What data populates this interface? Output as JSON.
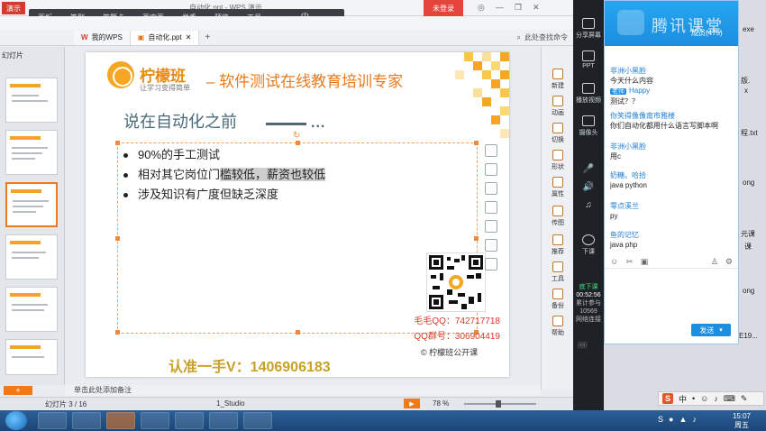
{
  "wps": {
    "title": "自动化.ppt - WPS 演示",
    "logo": "演示",
    "login_button": "未登录",
    "tabs": [
      {
        "label": "我的WPS"
      },
      {
        "label": "自动化.ppt"
      }
    ],
    "search_placeholder": "此处查找命令",
    "thumbnail_panel_label": "幻灯片",
    "notes_placeholder": "单击此处添加备注",
    "status": {
      "slide_index": "幻灯片 3 / 16",
      "theme": "1_Studio",
      "zoom": "78 %"
    }
  },
  "recorder_toolbar": {
    "items": [
      "画板",
      "签到",
      "答题卡",
      "画中画",
      "举手",
      "预览",
      "工具"
    ]
  },
  "slide": {
    "brand_name": "柠檬班",
    "brand_slogan": "让学习变得简单",
    "headline": "– 软件测试在线教育培训专家",
    "title": "说在自动化之前",
    "title_suffix": "...",
    "bullets": [
      {
        "text": "90%的手工测试"
      },
      {
        "text_a": "相对其它岗位门",
        "text_b": "槛较低，薪资也较低"
      },
      {
        "text": "涉及知识有广度但缺乏深度"
      }
    ],
    "qq_line": "毛毛QQ：742717718",
    "group_line": "QQ群号：306904419",
    "wechat_line": "认准一手V：1406906183",
    "footer_brand": "© 柠檬班公开课"
  },
  "task_pane": {
    "items": [
      "新建",
      "动画",
      "切换",
      "形状",
      "属性",
      "传图",
      "推荐",
      "工具",
      "备份",
      "帮助"
    ]
  },
  "recorder_sidebar": {
    "items": [
      "分享屏幕",
      "PPT",
      "播放视频",
      "摄像头",
      "下课"
    ],
    "status_label": "底下课",
    "timer": "00:52:56",
    "extra_1": "累计参与",
    "extra_2": "10569",
    "extra_3": "网络连接"
  },
  "chat": {
    "logo": "腾讯课堂",
    "member_count": "成员(475)",
    "messages": [
      {
        "name": "非洲小黑脸",
        "text": "今天什么内容",
        "role": ""
      },
      {
        "name": "Happy",
        "text": "测试？？",
        "role": "老师"
      },
      {
        "name": "你笑得像像南市雅楼",
        "text": "你们自动化都用什么语言写脚本啊",
        "role": ""
      },
      {
        "name": "非洲小黑脸",
        "text": "用c",
        "role": ""
      },
      {
        "name": "奶糖。哈拾",
        "text": "java python",
        "role": ""
      },
      {
        "name": "零点溪兰",
        "text": "py",
        "role": ""
      },
      {
        "name": "鱼的记忆",
        "text": "java php",
        "role": ""
      }
    ],
    "send_label": "发送"
  },
  "desktop_labels": [
    "exe",
    "版.",
    "x",
    "程.txt",
    "ong",
    "元课",
    "课",
    "ong",
    "E19...",
    ".txt"
  ],
  "ime": {
    "logo": "S",
    "lang": "中"
  },
  "taskbar": {
    "time": "15:07",
    "weekday": "周五"
  },
  "colors": {
    "accent_orange": "#f5a623",
    "wps_red": "#e5443b",
    "chat_blue": "#1d8de0"
  }
}
